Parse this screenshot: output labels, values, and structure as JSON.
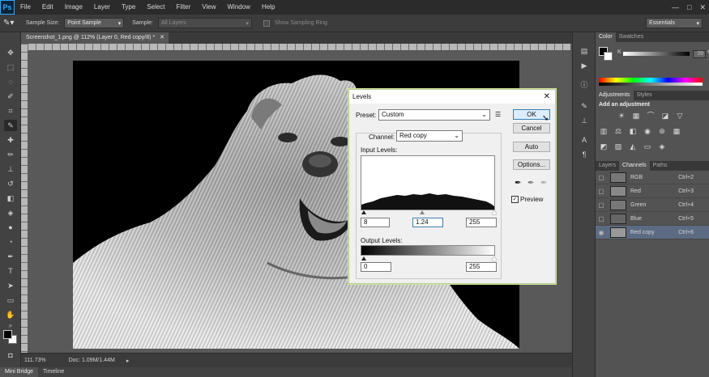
{
  "menubar": {
    "logo": "Ps",
    "items": [
      "File",
      "Edit",
      "Image",
      "Layer",
      "Type",
      "Select",
      "Filter",
      "View",
      "Window",
      "Help"
    ]
  },
  "options": {
    "sample_size_label": "Sample Size:",
    "sample_size_value": "Point Sample",
    "sample_label": "Sample:",
    "sample_value": "All Layers",
    "show_ring_label": "Show Sampling Ring",
    "workspace": "Essentials"
  },
  "document": {
    "tab_title": "Screenshot_1.png @ 112% (Layer 0, Red copy/8) *",
    "zoom": "111.73%",
    "doc_info": "Doc: 1.09M/1.44M"
  },
  "bottom_tabs": [
    "Mini Bridge",
    "Timeline"
  ],
  "panels": {
    "color_tabs": [
      "Color",
      "Swatches"
    ],
    "k_label": "K",
    "k_value": "39",
    "k_unit": "%",
    "adj_tabs": [
      "Adjustments",
      "Styles"
    ],
    "adj_title": "Add an adjustment",
    "channel_tabs": [
      "Layers",
      "Channels",
      "Paths"
    ],
    "channels": [
      {
        "name": "RGB",
        "shortcut": "Ctrl+2"
      },
      {
        "name": "Red",
        "shortcut": "Ctrl+3"
      },
      {
        "name": "Green",
        "shortcut": "Ctrl+4"
      },
      {
        "name": "Blue",
        "shortcut": "Ctrl+5"
      },
      {
        "name": "Red copy",
        "shortcut": "Ctrl+6"
      }
    ]
  },
  "levels": {
    "title": "Levels",
    "preset_label": "Preset:",
    "preset_value": "Custom",
    "channel_label": "Channel:",
    "channel_value": "Red copy",
    "input_label": "Input Levels:",
    "input_black": "8",
    "input_gamma": "1.24",
    "input_white": "255",
    "output_label": "Output Levels:",
    "output_black": "0",
    "output_white": "255",
    "ok": "OK",
    "cancel": "Cancel",
    "auto": "Auto",
    "options": "Options...",
    "preview_label": "Preview",
    "preview_checked": true,
    "close_glyph": "✕"
  }
}
